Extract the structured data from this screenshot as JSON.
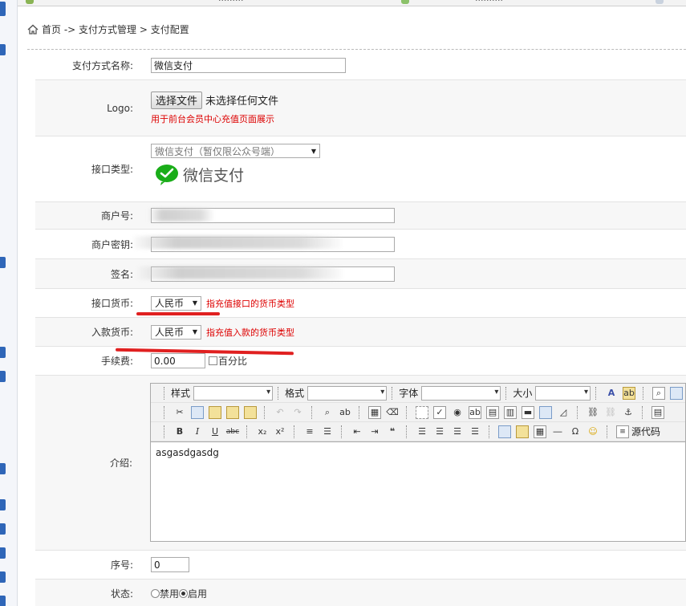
{
  "top_bar": {
    "fragments": [
      "·········",
      "··········"
    ]
  },
  "breadcrumb": {
    "text": "首页 -> 支付方式管理 > 支付配置"
  },
  "form": {
    "name": {
      "label": "支付方式名称:",
      "value": "微信支付"
    },
    "logo": {
      "label": "Logo:",
      "button": "选择文件",
      "status": "未选择任何文件",
      "note": "用于前台会员中心充值页面展示"
    },
    "interface_type": {
      "label": "接口类型:",
      "selected": "微信支付（暂仅限公众号端）",
      "logo_text": "微信支付"
    },
    "merchant_no": {
      "label": "商户号:",
      "value": ""
    },
    "merchant_key": {
      "label": "商户密钥:",
      "value": ""
    },
    "signature": {
      "label": "签名:",
      "value": ""
    },
    "interface_currency": {
      "label": "接口货币:",
      "selected": "人民币",
      "hint": "指充值接口的货币类型"
    },
    "deposit_currency": {
      "label": "入款货币:",
      "selected": "人民币",
      "hint": "指充值入款的货币类型"
    },
    "fee": {
      "label": "手续费:",
      "value": "0.00",
      "checkbox_label": "百分比"
    },
    "intro": {
      "label": "介绍:",
      "toolbar": {
        "style": "样式",
        "format": "格式",
        "font": "字体",
        "size": "大小",
        "source": "源代码"
      },
      "content": "asgasdgasdg"
    },
    "order": {
      "label": "序号:",
      "value": "0"
    },
    "status": {
      "label": "状态:",
      "options": [
        "禁用",
        "启用"
      ],
      "selected": "启用"
    }
  },
  "colors": {
    "hint_red": "#dd0000",
    "wechat_green": "#1aad19",
    "strip_blue": "#2f66b8"
  }
}
